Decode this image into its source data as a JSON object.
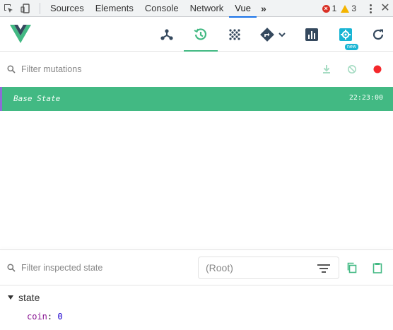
{
  "devtools": {
    "tabs": [
      "Sources",
      "Elements",
      "Console",
      "Network",
      "Vue"
    ],
    "active_tab": "Vue",
    "more_label": "»",
    "error_count": "1",
    "warning_count": "3"
  },
  "vue_toolbar": {
    "tools": [
      {
        "icon": "components-icon"
      },
      {
        "icon": "vuex-history-icon",
        "active": true
      },
      {
        "icon": "events-icon"
      },
      {
        "icon": "router-icon"
      },
      {
        "icon": "performance-icon"
      },
      {
        "icon": "settings-icon",
        "badge": "new"
      },
      {
        "icon": "refresh-icon"
      }
    ],
    "accent_color": "#42b983"
  },
  "mutations": {
    "filter_placeholder": "Filter mutations",
    "items": [
      {
        "name": "Base State",
        "time": "22:23:00",
        "selected": true
      }
    ]
  },
  "inspector": {
    "filter_placeholder": "Filter inspected state",
    "root_select": "(Root)",
    "section": "state",
    "props": [
      {
        "key": "coin",
        "value": "0"
      }
    ]
  }
}
